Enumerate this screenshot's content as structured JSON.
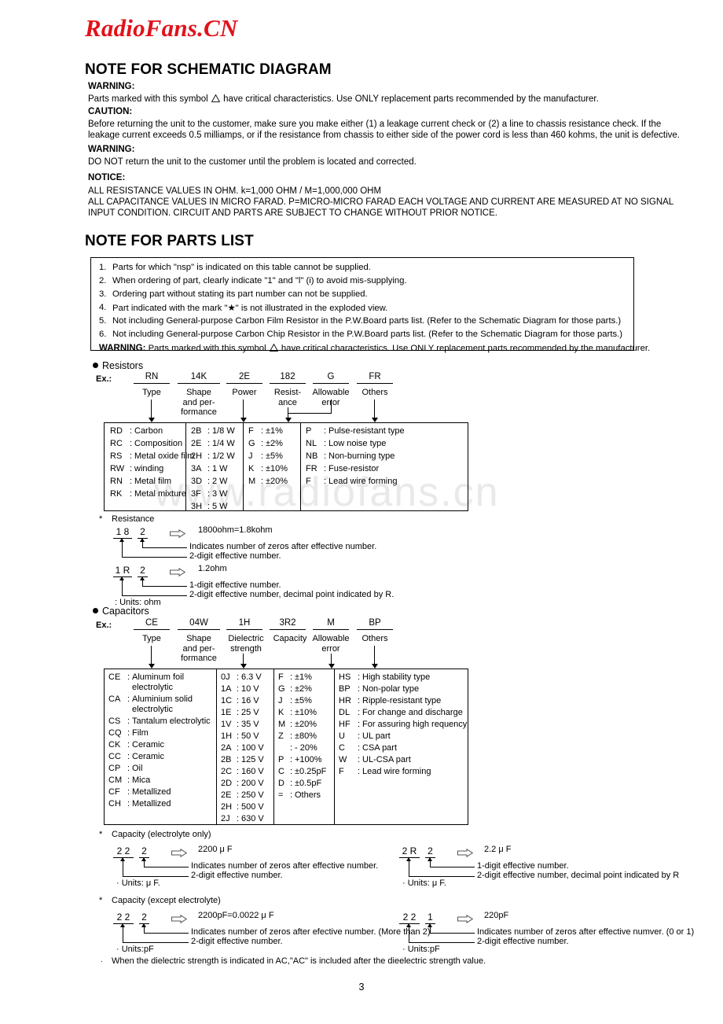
{
  "site_logo": "RadioFans.CN",
  "watermark": "www.radiofans.cn",
  "page_number": "3",
  "schematic": {
    "heading": "NOTE FOR SCHEMATIC DIAGRAM",
    "warning1_label": "WARNING:",
    "warning1_text_a": "Parts marked with this symbol",
    "warning1_text_b": "have critical characteristics. Use ONLY replacement parts recommended by the manufacturer.",
    "caution_label": "CAUTION:",
    "caution_line1": "Before returning the unit to the customer, make sure you make either (1) a leakage current check or (2) a line to chassis resistance check. If the",
    "caution_line2": "leakage current exceeds 0.5 milliamps, or if the resistance from chassis to either side of the power cord is less than 460 kohms, the unit is defective.",
    "warning2_label": "WARNING:",
    "warning2_text": "DO NOT return the unit to the customer until the problem is located and corrected.",
    "notice_label": "NOTICE:",
    "notice_line1": "ALL RESISTANCE VALUES IN OHM. k=1,000 OHM / M=1,000,000 OHM",
    "notice_line2": "ALL CAPACITANCE VALUES IN MICRO FARAD. P=MICRO-MICRO FARAD EACH VOLTAGE AND CURRENT ARE MEASURED AT NO SIGNAL",
    "notice_line3": "INPUT CONDITION. CIRCUIT AND PARTS ARE SUBJECT TO CHANGE WITHOUT PRIOR NOTICE."
  },
  "parts_list": {
    "heading": "NOTE FOR PARTS LIST",
    "items": [
      {
        "num": "1.",
        "text": "Parts for which \"nsp\" is indicated on this table cannot be supplied."
      },
      {
        "num": "2.",
        "text": "When ordering of part, clearly indicate \"1\" and \"l\" (i) to avoid mis-supplying."
      },
      {
        "num": "3.",
        "text": "Ordering part without stating its part number can not be supplied."
      },
      {
        "num": "4.",
        "text": "Part indicated with the mark \"★\" is not illustrated in the exploded view."
      },
      {
        "num": "5.",
        "text": "Not including General-purpose Carbon Film Resistor in the P.W.Board parts list. (Refer to the Schematic Diagram for those parts.)"
      },
      {
        "num": "6.",
        "text": "Not including General-purpose Carbon Chip Resistor in the P.W.Board parts list. (Refer to the Schematic Diagram for those parts.)"
      }
    ],
    "warning_label": "WARNING:",
    "warning_text_a": "Parts marked with this symbol",
    "warning_text_b": "have critical characteristics. Use ONLY replacement parts recommended by the manufacturer."
  },
  "resistors": {
    "title": "Resistors",
    "ex_label": "Ex.:",
    "codes": [
      "RN",
      "14K",
      "2E",
      "182",
      "G",
      "FR"
    ],
    "segment_labels": [
      "Type",
      "Shape\nand per-\nformance",
      "Power",
      "Resist-\nance",
      "Allowable\nerror",
      "Others"
    ],
    "col_type": [
      {
        "k": "RD",
        "v": "Carbon"
      },
      {
        "k": "RC",
        "v": "Composition"
      },
      {
        "k": "RS",
        "v": "Metal oxide film"
      },
      {
        "k": "RW",
        "v": "winding"
      },
      {
        "k": "RN",
        "v": "Metal film"
      },
      {
        "k": "RK",
        "v": "Metal mixture"
      }
    ],
    "col_power": [
      {
        "k": "2B",
        "v": "1/8 W"
      },
      {
        "k": "2E",
        "v": "1/4 W"
      },
      {
        "k": "2H",
        "v": "1/2 W"
      },
      {
        "k": "3A",
        "v": "1   W"
      },
      {
        "k": "3D",
        "v": "2   W"
      },
      {
        "k": "3F",
        "v": "3   W"
      },
      {
        "k": "3H",
        "v": "5   W"
      }
    ],
    "col_error": [
      {
        "k": "F",
        "v": "±1%"
      },
      {
        "k": "G",
        "v": "±2%"
      },
      {
        "k": "J",
        "v": "±5%"
      },
      {
        "k": "K",
        "v": "±10%"
      },
      {
        "k": "M",
        "v": "±20%"
      }
    ],
    "col_others": [
      {
        "k": "P",
        "v": "Pulse-resistant type"
      },
      {
        "k": "NL",
        "v": "Low noise type"
      },
      {
        "k": "NB",
        "v": "Non-burning type"
      },
      {
        "k": "FR",
        "v": "Fuse-resistor"
      },
      {
        "k": "F",
        "v": "Lead wire forming"
      }
    ],
    "resistance_note": "Resistance",
    "ex1": {
      "digits_a": "1 8",
      "digits_b": "2",
      "result": "1800ohm=1.8kohm",
      "desc_top": "Indicates number of zeros after effective number.",
      "desc_bottom": "2-digit effective number."
    },
    "ex2": {
      "digits_a": "1 R",
      "digits_b": "2",
      "result": "1.2ohm",
      "desc_top": "1-digit effective number.",
      "desc_bottom": "2-digit effective number, decimal point indicated by R.",
      "units": ": Units: ohm"
    }
  },
  "capacitors": {
    "title": "Capacitors",
    "ex_label": "Ex.:",
    "codes": [
      "CE",
      "04W",
      "1H",
      "3R2",
      "M",
      "BP"
    ],
    "segment_labels": [
      "Type",
      "Shape\nand per-\nformance",
      "Dielectric\nstrength",
      "Capacity",
      "Allowable\nerror",
      "Others"
    ],
    "col_type": [
      {
        "k": "CE",
        "v": "Aluminum foil",
        "v2": "electrolytic"
      },
      {
        "k": "CA",
        "v": "Aluminium solid",
        "v2": "electrolytic"
      },
      {
        "k": "CS",
        "v": "Tantalum electrolytic"
      },
      {
        "k": "CQ",
        "v": "Film"
      },
      {
        "k": "CK",
        "v": "Ceramic"
      },
      {
        "k": "CC",
        "v": "Ceramic"
      },
      {
        "k": "CP",
        "v": "Oil"
      },
      {
        "k": "CM",
        "v": "Mica"
      },
      {
        "k": "CF",
        "v": "Metallized"
      },
      {
        "k": "CH",
        "v": "Metallized"
      }
    ],
    "col_voltage": [
      {
        "k": "0J",
        "v": "6.3 V"
      },
      {
        "k": "1A",
        "v": "10  V"
      },
      {
        "k": "1C",
        "v": "16  V"
      },
      {
        "k": "1E",
        "v": "25  V"
      },
      {
        "k": "1V",
        "v": "35  V"
      },
      {
        "k": "1H",
        "v": "50  V"
      },
      {
        "k": "2A",
        "v": "100 V"
      },
      {
        "k": "2B",
        "v": "125 V"
      },
      {
        "k": "2C",
        "v": "160 V"
      },
      {
        "k": "2D",
        "v": "200 V"
      },
      {
        "k": "2E",
        "v": "250 V"
      },
      {
        "k": "2H",
        "v": "500 V"
      },
      {
        "k": "2J",
        "v": "630 V"
      }
    ],
    "col_error": [
      {
        "k": "F",
        "v": "±1%"
      },
      {
        "k": "G",
        "v": "±2%"
      },
      {
        "k": "J",
        "v": "±5%"
      },
      {
        "k": "K",
        "v": "±10%"
      },
      {
        "k": "M",
        "v": "±20%"
      },
      {
        "k": "Z",
        "v": "±80%"
      },
      {
        "k": "",
        "v": "- 20%"
      },
      {
        "k": "P",
        "v": "+100%"
      },
      {
        "k": "C",
        "v": "±0.25pF"
      },
      {
        "k": "D",
        "v": "±0.5pF"
      },
      {
        "k": "=",
        "v": "Others"
      }
    ],
    "col_others": [
      {
        "k": "HS",
        "v": "High stability type"
      },
      {
        "k": "BP",
        "v": "Non-polar type"
      },
      {
        "k": "HR",
        "v": "Ripple-resistant type"
      },
      {
        "k": "DL",
        "v": "For change and discharge"
      },
      {
        "k": "HF",
        "v": "For assuring high requency"
      },
      {
        "k": "U",
        "v": "UL part"
      },
      {
        "k": "C",
        "v": "CSA part"
      },
      {
        "k": "W",
        "v": "UL-CSA part"
      },
      {
        "k": "F",
        "v": "Lead wire forming"
      }
    ],
    "cap_elec_note": "Capacity (electrolyte only)",
    "cap_elec_left": {
      "digits_a": "2 2",
      "digits_b": "2",
      "result": "2200 μ F",
      "desc_top": "Indicates number of zeros after effective number.",
      "desc_bottom": "2-digit effective number.",
      "units": "· Units: μ F."
    },
    "cap_elec_right": {
      "digits_a": "2 R",
      "digits_b": "2",
      "result": "2.2 μ F",
      "desc_top": "1-digit effective number.",
      "desc_bottom": "2-digit effective number, decimal point indicated by R",
      "units": "· Units: μ F."
    },
    "cap_nonelec_note": "Capacity (except electrolyte)",
    "cap_nonelec_left": {
      "digits_a": "2 2",
      "digits_b": "2",
      "result": "2200pF=0.0022 μ F",
      "desc_top": "Indicates number of zeros after efective number. (More than 2)",
      "desc_bottom": "2-digit effective number.",
      "units": "· Units:pF"
    },
    "cap_nonelec_right": {
      "digits_a": "2 2",
      "digits_b": "1",
      "result": "220pF",
      "desc_top": "Indicates number of zeros after effective numver. (0 or 1)",
      "desc_bottom": "2-digit effective number.",
      "units": "· Units:pF"
    },
    "footnote": "When the dielectric strength is indicated in AC,\"AC\" is included after the dieelectric strength value."
  }
}
